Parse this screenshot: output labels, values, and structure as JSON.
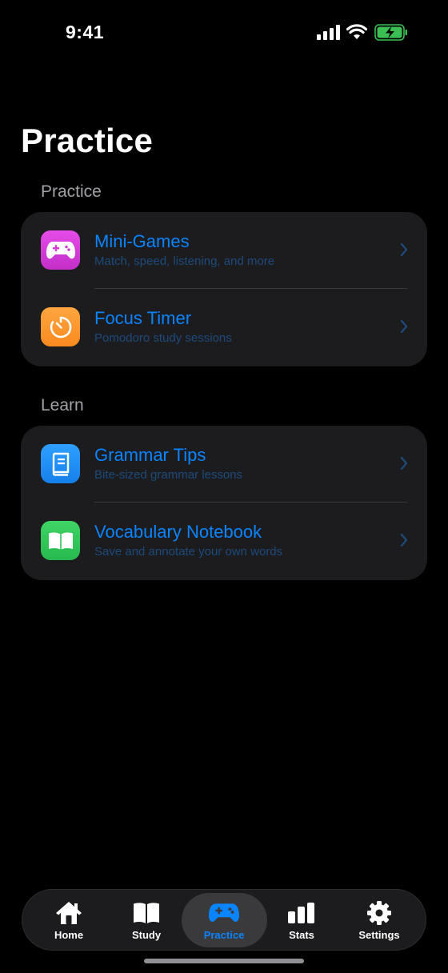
{
  "status_bar": {
    "time": "9:41"
  },
  "page_title": "Practice",
  "sections": [
    {
      "header": "Practice",
      "items": [
        {
          "title": "Mini-Games",
          "subtitle": "Match, speed, listening, and more",
          "icon": "gamepad-icon",
          "color": "#d63fd6"
        },
        {
          "title": "Focus Timer",
          "subtitle": "Pomodoro study sessions",
          "icon": "timer-icon",
          "color": "#ff9a2e"
        }
      ]
    },
    {
      "header": "Learn",
      "items": [
        {
          "title": "Grammar Tips",
          "subtitle": "Bite-sized grammar lessons",
          "icon": "book-icon",
          "color": "#1e8ef5"
        },
        {
          "title": "Vocabulary Notebook",
          "subtitle": "Save and annotate your own words",
          "icon": "open-book-icon",
          "color": "#2fc45a"
        }
      ]
    }
  ],
  "tab_bar": {
    "active": "Practice",
    "tabs": [
      {
        "label": "Home",
        "icon": "house-icon"
      },
      {
        "label": "Study",
        "icon": "book-open-icon"
      },
      {
        "label": "Practice",
        "icon": "gamepad-icon"
      },
      {
        "label": "Stats",
        "icon": "bar-chart-icon"
      },
      {
        "label": "Settings",
        "icon": "gear-icon"
      }
    ]
  },
  "colors": {
    "accent": "#0a84ff",
    "background": "#000000",
    "card": "#1c1c1e"
  }
}
